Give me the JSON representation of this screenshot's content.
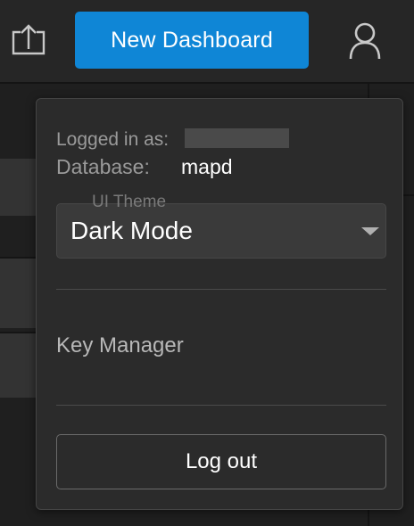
{
  "topbar": {
    "share_icon": "share-upload-icon",
    "new_dashboard_label": "New Dashboard",
    "user_icon": "user-icon",
    "accent_color": "#0f86d6"
  },
  "user_menu": {
    "logged_in_label": "Logged in as:",
    "database_label": "Database:",
    "database_value": "mapd",
    "theme": {
      "label": "UI Theme",
      "selected": "Dark Mode"
    },
    "key_manager_label": "Key Manager",
    "logout_label": "Log out"
  }
}
